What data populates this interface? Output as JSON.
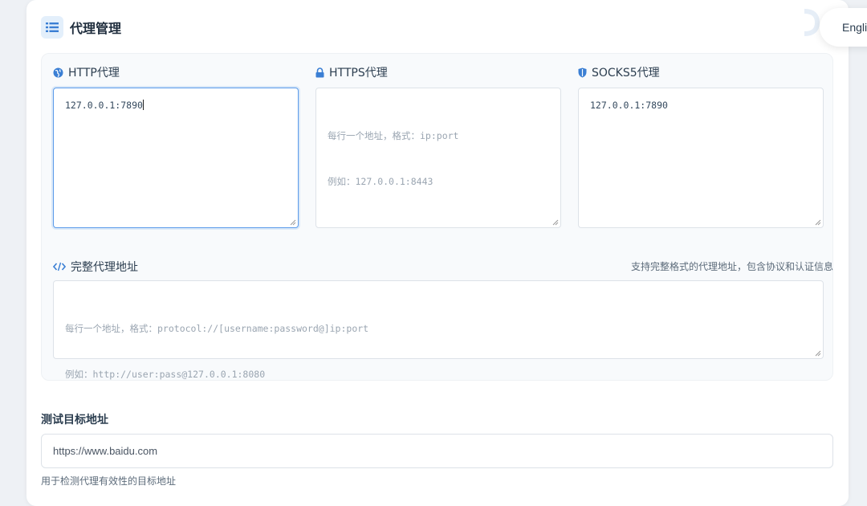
{
  "header": {
    "title": "代理管理",
    "icon": "list-icon"
  },
  "proxies": [
    {
      "label": "HTTP代理",
      "icon": "globe-icon",
      "value": "127.0.0.1:7890",
      "placeholder": ""
    },
    {
      "label": "HTTPS代理",
      "icon": "lock-icon",
      "value": "",
      "placeholder_line1": "每行一个地址，格式：ip:port",
      "placeholder_line2": "例如：127.0.0.1:8443"
    },
    {
      "label": "SOCKS5代理",
      "icon": "shield-icon",
      "value": "127.0.0.1:7890",
      "placeholder": ""
    }
  ],
  "full_proxy": {
    "label": "完整代理地址",
    "icon": "code-icon",
    "hint": "支持完整格式的代理地址，包含协议和认证信息",
    "placeholder_line1": "每行一个地址，格式：protocol://[username:password@]ip:port",
    "placeholder_line2": "例如：http://user:pass@127.0.0.1:8080"
  },
  "test_target": {
    "label": "测试目标地址",
    "value": "https://www.baidu.com",
    "help": "用于检测代理有效性的目标地址"
  },
  "language_button": {
    "label": "Engli"
  },
  "colors": {
    "accent": "#3b7fd4",
    "focus_border": "#5b9bea",
    "background": "#eef1f5"
  }
}
